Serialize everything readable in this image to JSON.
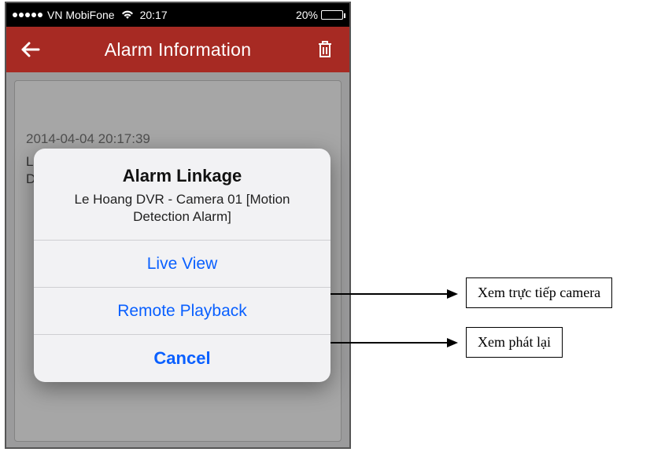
{
  "status": {
    "carrier": "VN MobiFone",
    "time": "20:17",
    "battery_pct": "20%"
  },
  "nav": {
    "title": "Alarm Information"
  },
  "list": {
    "timestamp": "2014-04-04 20:17:39",
    "row_line1": "Le",
    "row_line2": "De"
  },
  "dialog": {
    "title": "Alarm Linkage",
    "subtitle": "Le Hoang DVR - Camera 01 [Motion Detection Alarm]",
    "live_view": "Live View",
    "remote_playback": "Remote Playback",
    "cancel": "Cancel"
  },
  "annotations": {
    "live_view_note": "Xem trực tiếp camera",
    "playback_note": "Xem phát lại"
  }
}
